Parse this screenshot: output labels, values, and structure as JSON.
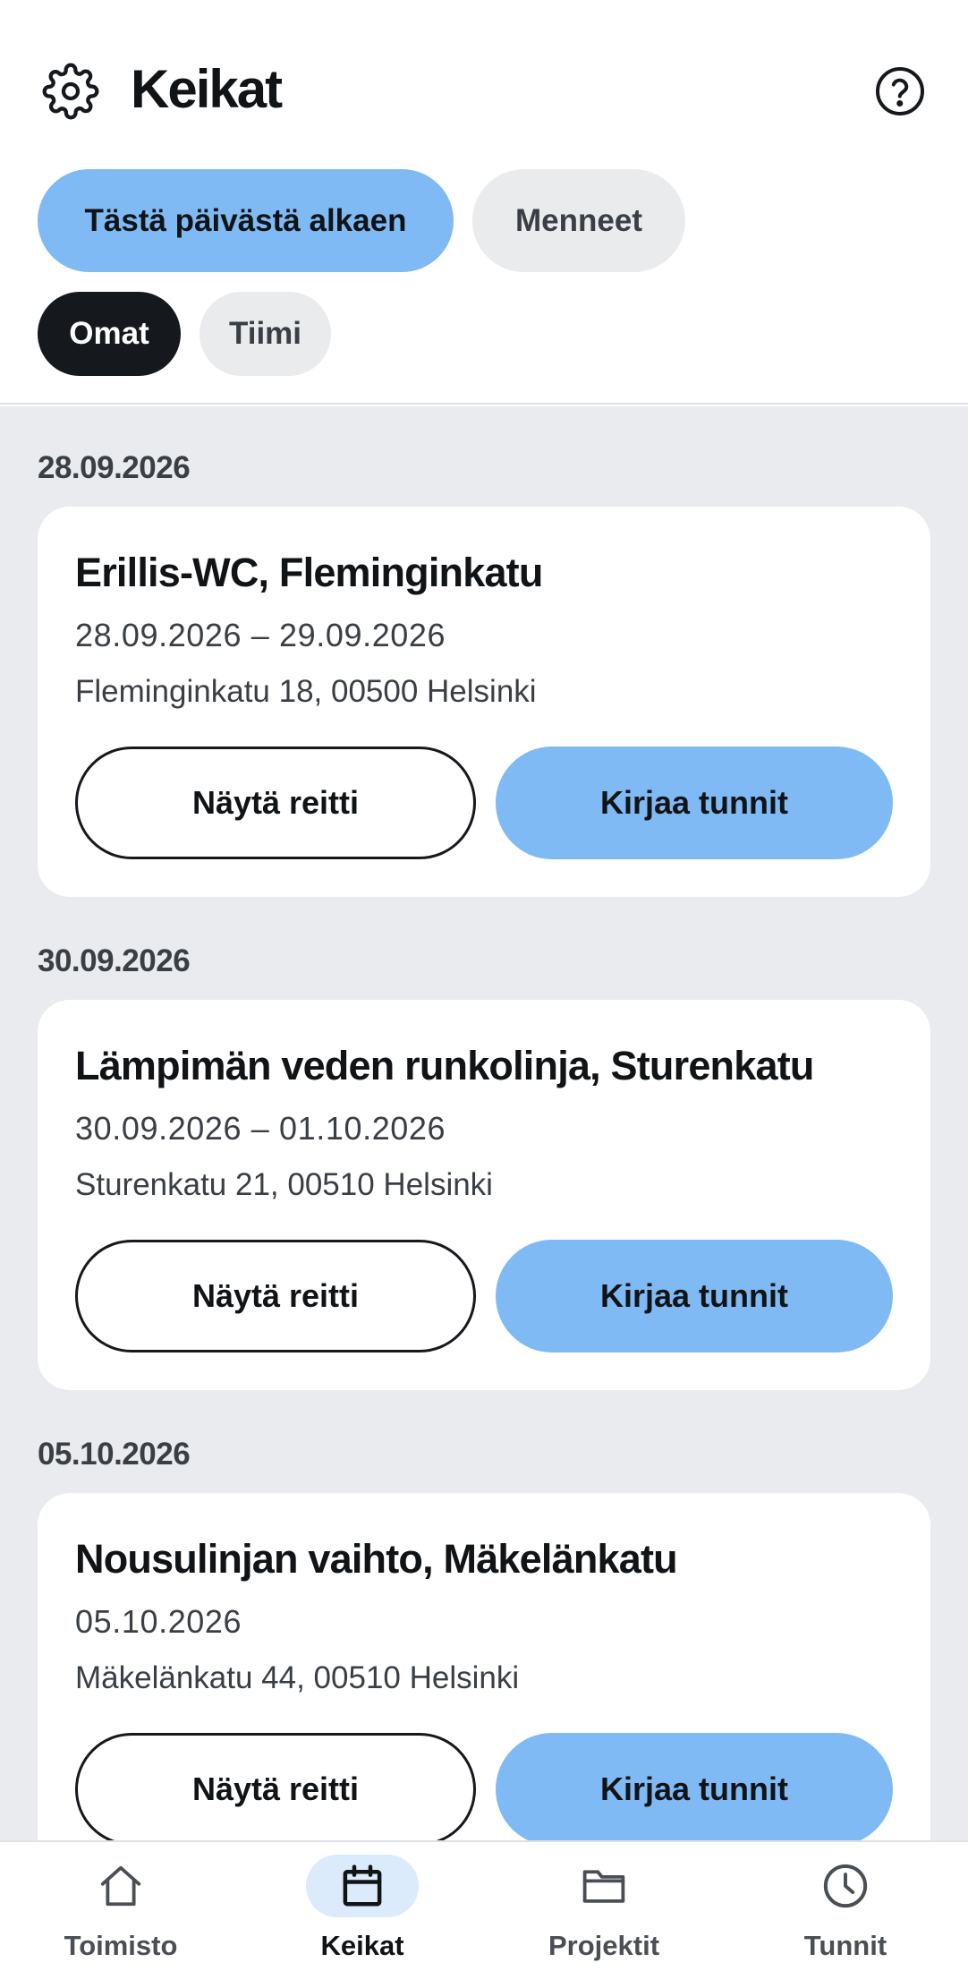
{
  "header": {
    "title": "Keikat",
    "settings_icon": "gear-icon",
    "help_icon": "help-circle-icon"
  },
  "filters": {
    "date_range": {
      "selected": "Tästä päivästä alkaen",
      "options": [
        "Tästä päivästä alkaen",
        "Menneet"
      ]
    },
    "owner": {
      "selected": "Omat",
      "options": [
        "Omat",
        "Tiimi"
      ]
    }
  },
  "groups": [
    {
      "date": "28.09.2026",
      "card": {
        "title": "Erillis-WC, Fleminginkatu",
        "dates": "28.09.2026 – 29.09.2026",
        "address": "Fleminginkatu 18, 00500 Helsinki",
        "route_label": "Näytä reitti",
        "log_label": "Kirjaa tunnit"
      }
    },
    {
      "date": "30.09.2026",
      "card": {
        "title": "Lämpimän veden runkolinja, Sturenkatu",
        "dates": "30.09.2026 – 01.10.2026",
        "address": "Sturenkatu 21, 00510 Helsinki",
        "route_label": "Näytä reitti",
        "log_label": "Kirjaa tunnit"
      }
    },
    {
      "date": "05.10.2026",
      "card": {
        "title": "Nousulinjan vaihto, Mäkelänkatu",
        "dates": "05.10.2026",
        "address": "Mäkelänkatu 44, 00510 Helsinki",
        "route_label": "Näytä reitti",
        "log_label": "Kirjaa tunnit"
      }
    }
  ],
  "nav": {
    "active": "Keikat",
    "items": [
      {
        "label": "Toimisto",
        "icon": "home-icon"
      },
      {
        "label": "Keikat",
        "icon": "calendar-icon"
      },
      {
        "label": "Projektit",
        "icon": "folder-icon"
      },
      {
        "label": "Tunnit",
        "icon": "clock-icon"
      }
    ]
  },
  "colors": {
    "accent": "#7fbaf4",
    "chip_inactive": "#e9ebed",
    "chip_dark": "#15181c",
    "list_background": "#e9ebee",
    "nav_active_pill": "#dcebfb"
  }
}
